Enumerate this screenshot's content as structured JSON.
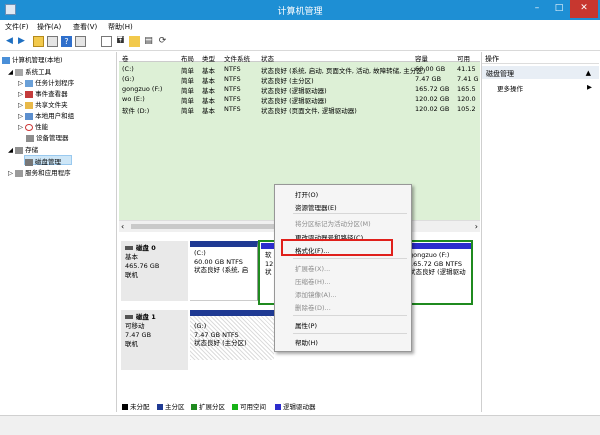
{
  "window": {
    "title": "计算机管理",
    "min": "–",
    "max": "□",
    "close": "✕"
  },
  "menu": [
    "文件(F)",
    "操作(A)",
    "查看(V)",
    "帮助(H)"
  ],
  "tree": {
    "root": "计算机管理(本地)",
    "system_tools": "系统工具",
    "task_scheduler": "任务计划程序",
    "event_viewer": "事件查看器",
    "shared_folders": "共享文件夹",
    "local_users": "本地用户和组",
    "performance": "性能",
    "device_manager": "设备管理器",
    "storage": "存储",
    "disk_management": "磁盘管理",
    "services": "服务和应用程序"
  },
  "volumes": {
    "headers": [
      "卷",
      "布局",
      "类型",
      "文件系统",
      "状态",
      "容量",
      "可用"
    ],
    "rows": [
      {
        "vol": "(C:)",
        "layout": "简单",
        "type": "基本",
        "fs": "NTFS",
        "status": "状态良好 (系统, 启动, 页面文件, 活动, 故障转储, 主分区)",
        "cap": "60.00 GB",
        "free": "41.15"
      },
      {
        "vol": "(G:)",
        "layout": "简单",
        "type": "基本",
        "fs": "NTFS",
        "status": "状态良好 (主分区)",
        "cap": "7.47 GB",
        "free": "7.41 G"
      },
      {
        "vol": "gongzuo (F:)",
        "layout": "简单",
        "type": "基本",
        "fs": "NTFS",
        "status": "状态良好 (逻辑驱动器)",
        "cap": "165.72 GB",
        "free": "165.5"
      },
      {
        "vol": "wo (E:)",
        "layout": "简单",
        "type": "基本",
        "fs": "NTFS",
        "status": "状态良好 (逻辑驱动器)",
        "cap": "120.02 GB",
        "free": "120.0"
      },
      {
        "vol": "软件 (D:)",
        "layout": "简单",
        "type": "基本",
        "fs": "NTFS",
        "status": "状态良好 (页面文件, 逻辑驱动器)",
        "cap": "120.02 GB",
        "free": "105.2"
      }
    ]
  },
  "disk0": {
    "name": "磁盘 0",
    "type": "基本",
    "size": "465.76 GB",
    "state": "联机",
    "c_name": "(C:)",
    "c_size": "60.00 GB NTFS",
    "c_status": "状态良好 (系统, 启",
    "d_name": "软",
    "d_size": "12",
    "d_status": "状",
    "f_name": "gongzuo  (F:)",
    "f_size": "165.72 GB NTFS",
    "f_status": "状态良好 (逻辑驱动"
  },
  "disk1": {
    "name": "磁盘 1",
    "type": "可移动",
    "size": "7.47 GB",
    "state": "联机",
    "g_name": "(G:)",
    "g_size": "7.47 GB NTFS",
    "g_status": "状态良好 (主分区)"
  },
  "legend": [
    "未分配",
    "主分区",
    "扩展分区",
    "可用空间",
    "逻辑驱动器"
  ],
  "actions": {
    "header": "操作",
    "group": "磁盘管理",
    "more": "更多操作"
  },
  "context_menu": {
    "open": "打开(O)",
    "explore": "资源管理器(E)",
    "mark_active": "将分区标记为活动分区(M)",
    "change_letter": "更改驱动器号和路径(C)...",
    "format": "格式化(F)...",
    "extend": "扩展卷(X)...",
    "shrink": "压缩卷(H)...",
    "add_mirror": "添加镜像(A)...",
    "delete": "删除卷(D)...",
    "properties": "属性(P)",
    "help": "帮助(H)"
  },
  "colors": {
    "title": "#1e8fd4",
    "primary": "#1f3a93",
    "logical": "#2c2ccc",
    "free_space": "#17b317",
    "extended": "#1f8a1f",
    "unallocated": "#000000",
    "highlight": "#e0201b"
  }
}
